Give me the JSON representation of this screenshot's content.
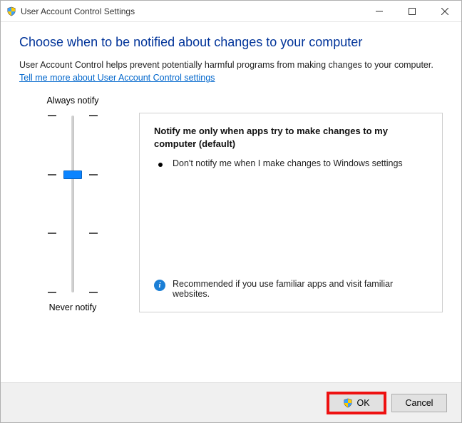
{
  "title": "User Account Control Settings",
  "heading": "Choose when to be notified about changes to your computer",
  "subtext": "User Account Control helps prevent potentially harmful programs from making changes to your computer.",
  "link": "Tell me more about User Account Control settings",
  "slider": {
    "top_label": "Always notify",
    "bottom_label": "Never notify"
  },
  "detail": {
    "title": "Notify me only when apps try to make changes to my computer (default)",
    "bullet": "Don't notify me when I make changes to Windows settings",
    "recommend": "Recommended if you use familiar apps and visit familiar websites."
  },
  "buttons": {
    "ok": "OK",
    "cancel": "Cancel"
  },
  "info_glyph": "i"
}
